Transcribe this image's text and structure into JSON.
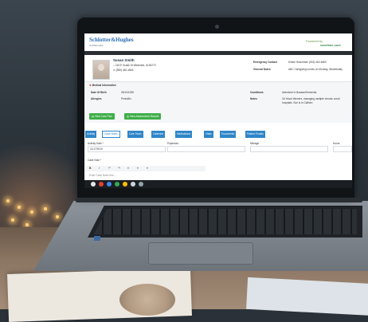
{
  "app": {
    "brand": "Schlotter&Hughes",
    "brand_sub": "HOMECARE",
    "powered_by": "Powered by",
    "powered_logo": "caretime.com"
  },
  "client": {
    "name": "Susan Smith",
    "address": "215 E Grade St Winterset, IA 50273",
    "phone": "(555) 462-4863"
  },
  "contact": {
    "emergency_label": "Emergency Contact",
    "emergency_value": "Kristie Hirschman  (515) 462-4863",
    "notes_label": "General Notes",
    "notes_value": "ABC Caregiving comes on Monday, Wednesday"
  },
  "medical": {
    "heading": "Medical Information",
    "dob_label": "Date Of Birth",
    "dob_value": "05/10/1935",
    "allergies_label": "Allergies",
    "allergies_value": "Penicillin",
    "conditions_label": "Conditions",
    "conditions_value": "Alzheimer's Disease/Dementia",
    "notes_label": "Notes",
    "notes_value_1": "On blood thinners, managing multiple chronic condi",
    "notes_value_2": "hospitals. Son is in Californ"
  },
  "actions": {
    "care_plan": "View Care Plan",
    "assessment": "View Assessment Results"
  },
  "tabs": [
    {
      "label": "Activity"
    },
    {
      "label": "Case Notes"
    },
    {
      "label": "Care Team"
    },
    {
      "label": "Calendar"
    },
    {
      "label": "Medications"
    },
    {
      "label": "Vitals"
    },
    {
      "label": "Documents"
    },
    {
      "label": "Patient Portals"
    }
  ],
  "form": {
    "activity_date_label": "Activity Date *",
    "activity_date_value": "11/17/2019",
    "expenses_label": "Expenses",
    "mileage_label": "Mileage",
    "hours_label": "Hours",
    "case_note_label": "Case Note *",
    "case_note_placeholder": "Enter Case Note here..."
  },
  "editor": {
    "bold": "B",
    "italic": "I",
    "undo": "↶",
    "redo": "↷",
    "align_left": "≡",
    "align_center": "≡",
    "align_right": "≡"
  },
  "icons": {
    "phone": "phone-icon",
    "home": "home-icon",
    "medical": "medical-cross-icon"
  },
  "colors": {
    "accent_blue": "#2f86c8",
    "button_green": "#3fae49",
    "brand_blue": "#2b6fb3"
  }
}
